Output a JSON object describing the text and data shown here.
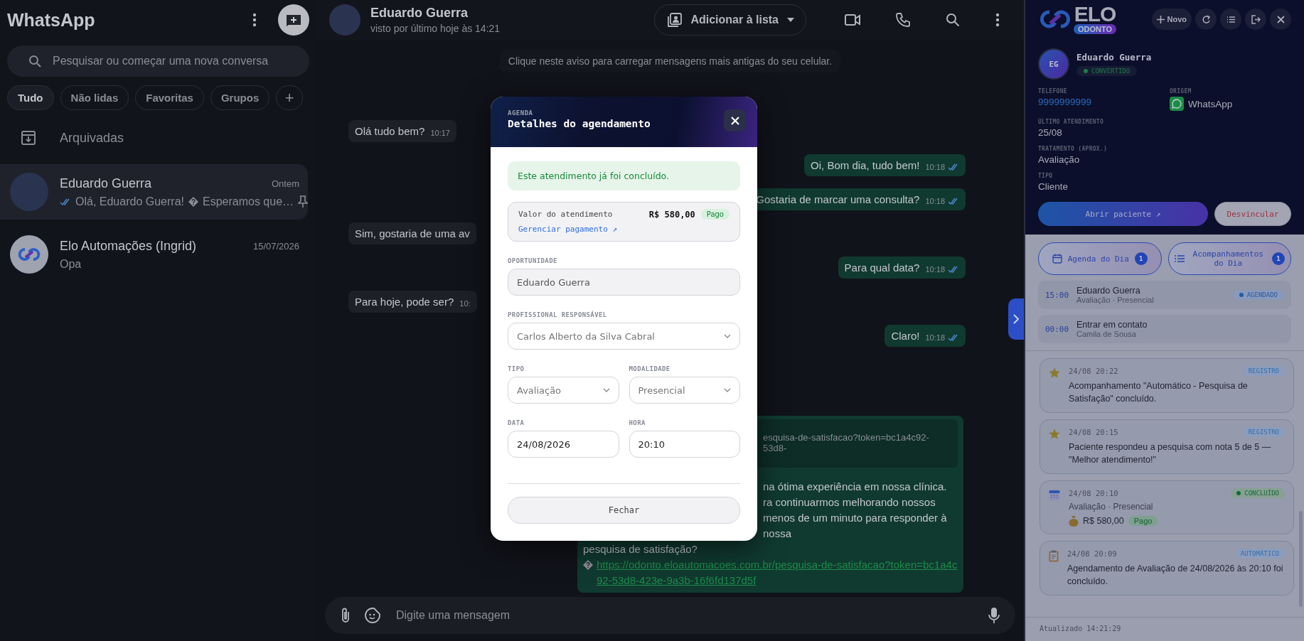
{
  "sidebar": {
    "title": "WhatsApp",
    "search": {
      "placeholder": "Pesquisar ou começar uma nova conversa"
    },
    "filters": [
      {
        "label": "Tudo",
        "selected": true
      },
      {
        "label": "Não lidas",
        "selected": false
      },
      {
        "label": "Favoritas",
        "selected": false
      },
      {
        "label": "Grupos",
        "selected": false
      }
    ],
    "add_filter": "+",
    "archived": "Arquivadas",
    "chats": [
      {
        "name": "Eduardo Guerra",
        "time": "Ontem",
        "preview": "Olá, Eduardo Guerra!",
        "preview_end": "Esperamos que…",
        "kind": "photo",
        "read": true,
        "pinned": true,
        "selected": true
      },
      {
        "name": "Elo Automações (Ingrid)",
        "time": "15/07/2026",
        "preview": "Opa",
        "kind": "logo",
        "read": false,
        "pinned": false,
        "selected": false
      }
    ]
  },
  "chat": {
    "name": "Eduardo Guerra",
    "last_seen": "visto por último hoje às 14:21",
    "add_to_list": "Adicionar à lista",
    "notice": "Clique neste aviso para carregar mensagens mais antigas do seu celular.",
    "messages": [
      {
        "kind": "in",
        "text": "Olá tudo bem?",
        "time": "10:17"
      },
      {
        "kind": "out",
        "text": "Oi, Bom dia, tudo bem!",
        "time": "10:18",
        "read": true
      },
      {
        "kind": "out",
        "text": "Gostaria de marcar uma consulta?",
        "time": "10:18",
        "read": true
      },
      {
        "kind": "in",
        "text": "Sim, gostaria de uma av"
      },
      {
        "kind": "out",
        "text": "Para qual data?",
        "time": "10:18",
        "read": true
      },
      {
        "kind": "in",
        "text": "Para hoje, pode ser?",
        "time": "10:"
      },
      {
        "kind": "out",
        "text": "Claro!",
        "time": "10:18",
        "read": true
      },
      {
        "kind": "long",
        "preview": "esquisa-de-satisfacao?token=bc1a4c92-53d8-",
        "lines": [
          {
            "text": "na ótima experiência em nossa clínica.",
            "cut": true
          },
          {
            "text": "ra continuarmos melhorando nossos",
            "cut": true
          },
          {
            "text": "menos de um minuto para responder à nossa",
            "cut": true
          },
          {
            "text": "pesquisa de satisfação?",
            "cut": false
          }
        ],
        "link": "https://odonto.eloautomacoes.com.br/pesquisa-de-satisfacao?token=bc1a4c92-53d8-423e-9a3b-16f6fd137d5f"
      }
    ],
    "composer": {
      "placeholder": "Digite uma mensagem"
    }
  },
  "modal": {
    "eyebrow": "AGENDA",
    "title": "Detalhes do agendamento",
    "alert": "Este atendimento já foi concluído.",
    "payment": {
      "label": "Valor do atendimento",
      "amount": "R$ 580,00",
      "status": "Pago",
      "link": "Gerenciar pagamento ↗"
    },
    "rows": [
      [
        {
          "label": "OPORTUNIDADE",
          "value": "Eduardo Guerra",
          "kind": "readonly"
        }
      ],
      [
        {
          "label": "PROFISSIONAL RESPONSÁVEL",
          "value": "Carlos Alberto da Silva Cabral",
          "kind": "select"
        }
      ],
      [
        {
          "label": "TIPO",
          "value": "Avaliação",
          "kind": "select"
        },
        {
          "label": "MODALIDADE",
          "value": "Presencial",
          "kind": "select"
        }
      ],
      [
        {
          "label": "DATA",
          "value": "24/08/2026",
          "kind": "input"
        },
        {
          "label": "HORA",
          "value": "20:10",
          "kind": "input"
        }
      ]
    ],
    "close_button": "Fechar"
  },
  "panel": {
    "logo": {
      "word": "ELO",
      "badge": "ODONTO"
    },
    "new_button": "Novo",
    "contact": {
      "initials": "EG",
      "name": "Eduardo Guerra",
      "status": "CONVERTIDO",
      "info": [
        {
          "label": "TELEFONE",
          "value": "9999999999",
          "kind": "phone"
        },
        {
          "label": "ORIGEM",
          "value": "WhatsApp",
          "kind": "origin"
        },
        {
          "label": "ÚLTIMO ATENDIMENTO",
          "value": "25/08",
          "kind": "text"
        },
        {
          "label": "TRATAMENTO (APROX.)",
          "value": "Avaliação",
          "kind": "text"
        },
        {
          "label": "TIPO",
          "value": "Cliente",
          "kind": "text"
        }
      ]
    },
    "actions": {
      "open": "Abrir paciente ↗",
      "unlink": "Desvincular"
    },
    "tabs": [
      {
        "label": "Agenda do Dia",
        "count": "1",
        "kind": "agenda"
      },
      {
        "label": "Acompanhamentos do Dia",
        "count": "1",
        "kind": "followups"
      }
    ],
    "agenda": [
      {
        "time": "15:00",
        "title": "Eduardo Guerra",
        "subtitle": "Avaliação · Presencial",
        "status": "AGENDADO"
      },
      {
        "time": "00:00",
        "title": "Entrar em contato",
        "subtitle": "Camila de Sousa"
      }
    ],
    "timeline": [
      {
        "kind": "star",
        "date": "24/08 20:22",
        "tag": {
          "label": "REGISTRO",
          "color": "#2f6fb0",
          "dot": false
        },
        "text": "Acompanhamento \"Automático - Pesquisa de Satisfação\" concluído."
      },
      {
        "kind": "star",
        "date": "24/08 20:15",
        "tag": {
          "label": "REGISTRO",
          "color": "#2f6fb0",
          "dot": false
        },
        "text": "Paciente respondeu a pesquisa com nota 5 de 5 — \"Melhor atendimento!\""
      },
      {
        "kind": "calendar",
        "date": "24/08 20:10",
        "tag": {
          "label": "CONCLUÍDO",
          "color": "#136b36",
          "dot": true
        },
        "subtitle": "Avaliação · Presencial",
        "amount": "R$ 580,00",
        "paid": "Pago"
      },
      {
        "kind": "clipboard",
        "date": "24/08 20:09",
        "tag": {
          "label": "AUTOMÁTICO",
          "color": "#2f6fb0",
          "dot": false
        },
        "text": "Agendamento de Avaliação de 24/08/2026 às 20:10 foi concluído."
      }
    ],
    "updated": "Atualizado 14:21:29"
  }
}
